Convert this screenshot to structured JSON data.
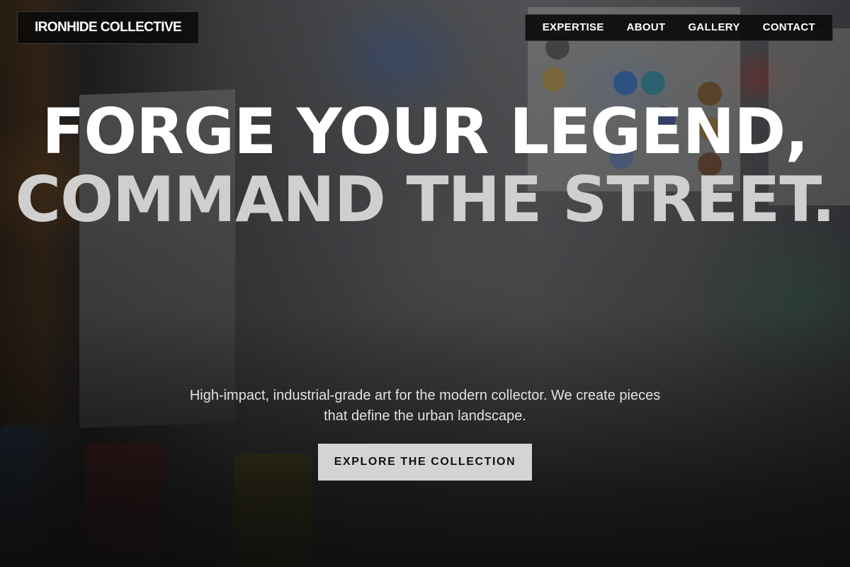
{
  "brand": {
    "name": "IRONHIDE COLLECTIVE"
  },
  "nav": {
    "items": [
      {
        "label": "EXPERTISE"
      },
      {
        "label": "ABOUT"
      },
      {
        "label": "GALLERY"
      },
      {
        "label": "CONTACT"
      }
    ]
  },
  "hero": {
    "headline_line1": "FORGE YOUR LEGEND,",
    "headline_line2": "COMMAND THE STREET.",
    "subtitle": "High-impact, industrial-grade art for the modern collector. We create pieces that define the urban landscape.",
    "cta_label": "EXPLORE THE COLLECTION",
    "background": "paint-splattered-studio-photo"
  },
  "colors": {
    "headline_primary": "#ffffff",
    "headline_secondary": "#cfcfcf",
    "cta_background": "#d4d4d4",
    "bar_background": "#0c0c0c"
  }
}
